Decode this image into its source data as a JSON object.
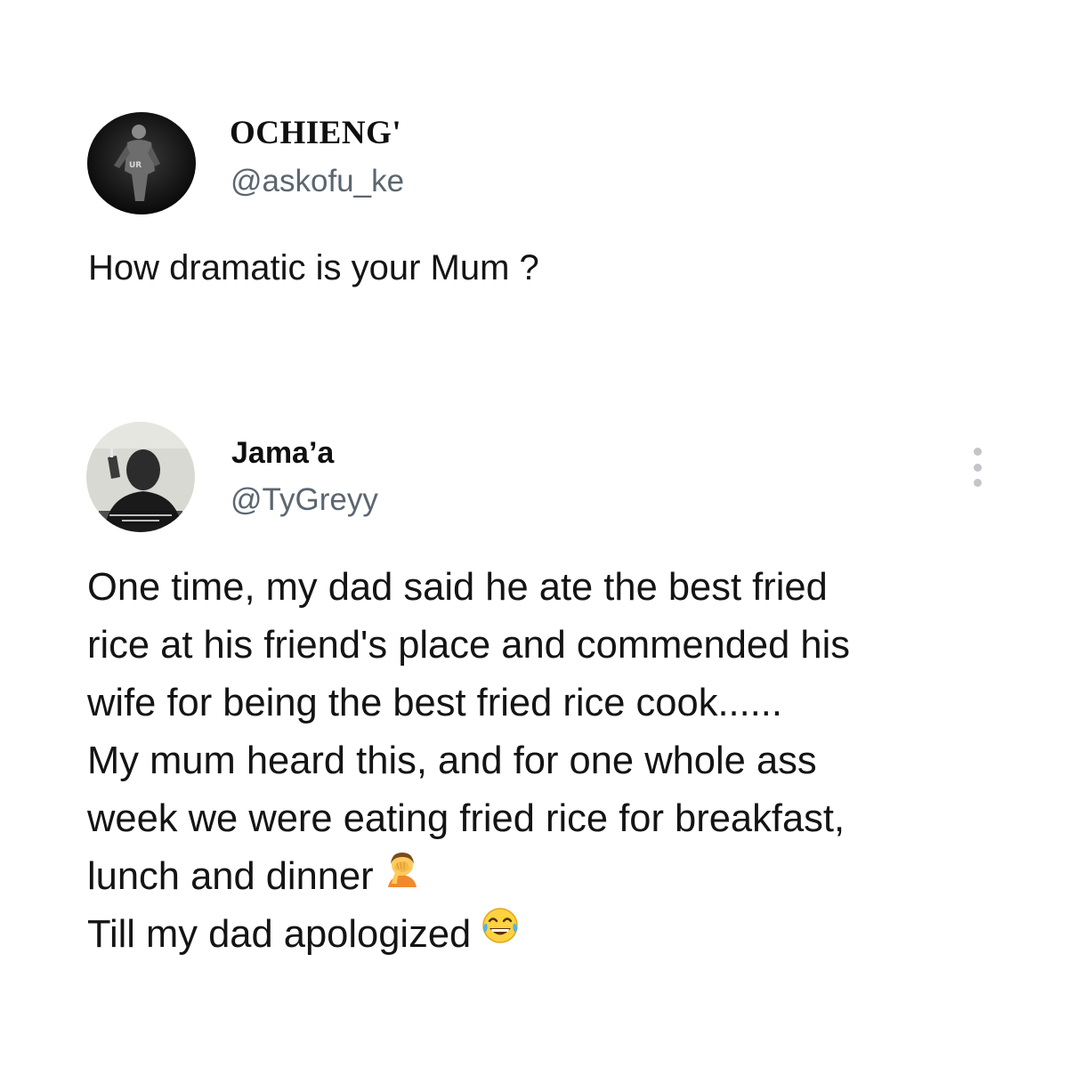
{
  "tweet_1": {
    "display_name": "OCHIENG'",
    "handle": "@askofu_ke",
    "avatar_icon": "profile-photo-person-standing",
    "avatar_caption": "UR",
    "text": "How dramatic is your Mum ?"
  },
  "tweet_2": {
    "display_name": "Jama’a",
    "handle": "@TyGreyy",
    "avatar_icon": "profile-photo-man-holding-cigarette",
    "more_icon": "vertical-ellipsis-icon",
    "lines": [
      "One time, my dad said he ate the best fried",
      "rice at his friend's place and commended his",
      "wife for being the best fried rice cook......",
      "My mum heard this, and for one whole ass",
      "week we were eating fried rice for breakfast,",
      "lunch and dinner",
      "Till my dad apologized"
    ],
    "emoji_line_6": "person-facepalming-emoji",
    "emoji_line_7": "face-with-tears-of-joy-emoji"
  },
  "colors": {
    "text": "#141414",
    "handle": "#5b6670",
    "menu_dots": "#c2c6cb",
    "background": "#ffffff"
  }
}
